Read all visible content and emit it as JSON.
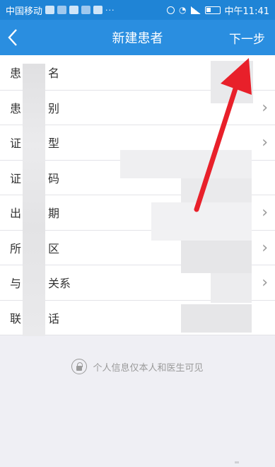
{
  "status_bar": {
    "carrier": "中国移动",
    "dots": "···",
    "time": "中午11:41"
  },
  "nav": {
    "back_icon": "chevron-left-icon",
    "title": "新建患者",
    "next_label": "下一步"
  },
  "form": {
    "rows": [
      {
        "label": "患",
        "label_tail": "名",
        "has_chevron": false
      },
      {
        "label": "患",
        "label_tail": "别",
        "has_chevron": true
      },
      {
        "label": "证",
        "label_tail": "型",
        "has_chevron": true
      },
      {
        "label": "证",
        "label_tail": "码",
        "has_chevron": false
      },
      {
        "label": "出",
        "label_tail": "期",
        "has_chevron": true
      },
      {
        "label": "所",
        "label_tail": "区",
        "has_chevron": true
      },
      {
        "label": "与",
        "label_tail": "关系",
        "has_chevron": true
      },
      {
        "label": "联",
        "label_tail": "话",
        "has_chevron": false
      }
    ]
  },
  "privacy": {
    "icon": "lock-icon",
    "text": "个人信息仅本人和医生可见"
  },
  "colors": {
    "status_bar_bg": "#1f84d6",
    "nav_bg": "#2a8ee0",
    "page_bg": "#efeff4",
    "annotation_arrow": "#e8202a"
  }
}
